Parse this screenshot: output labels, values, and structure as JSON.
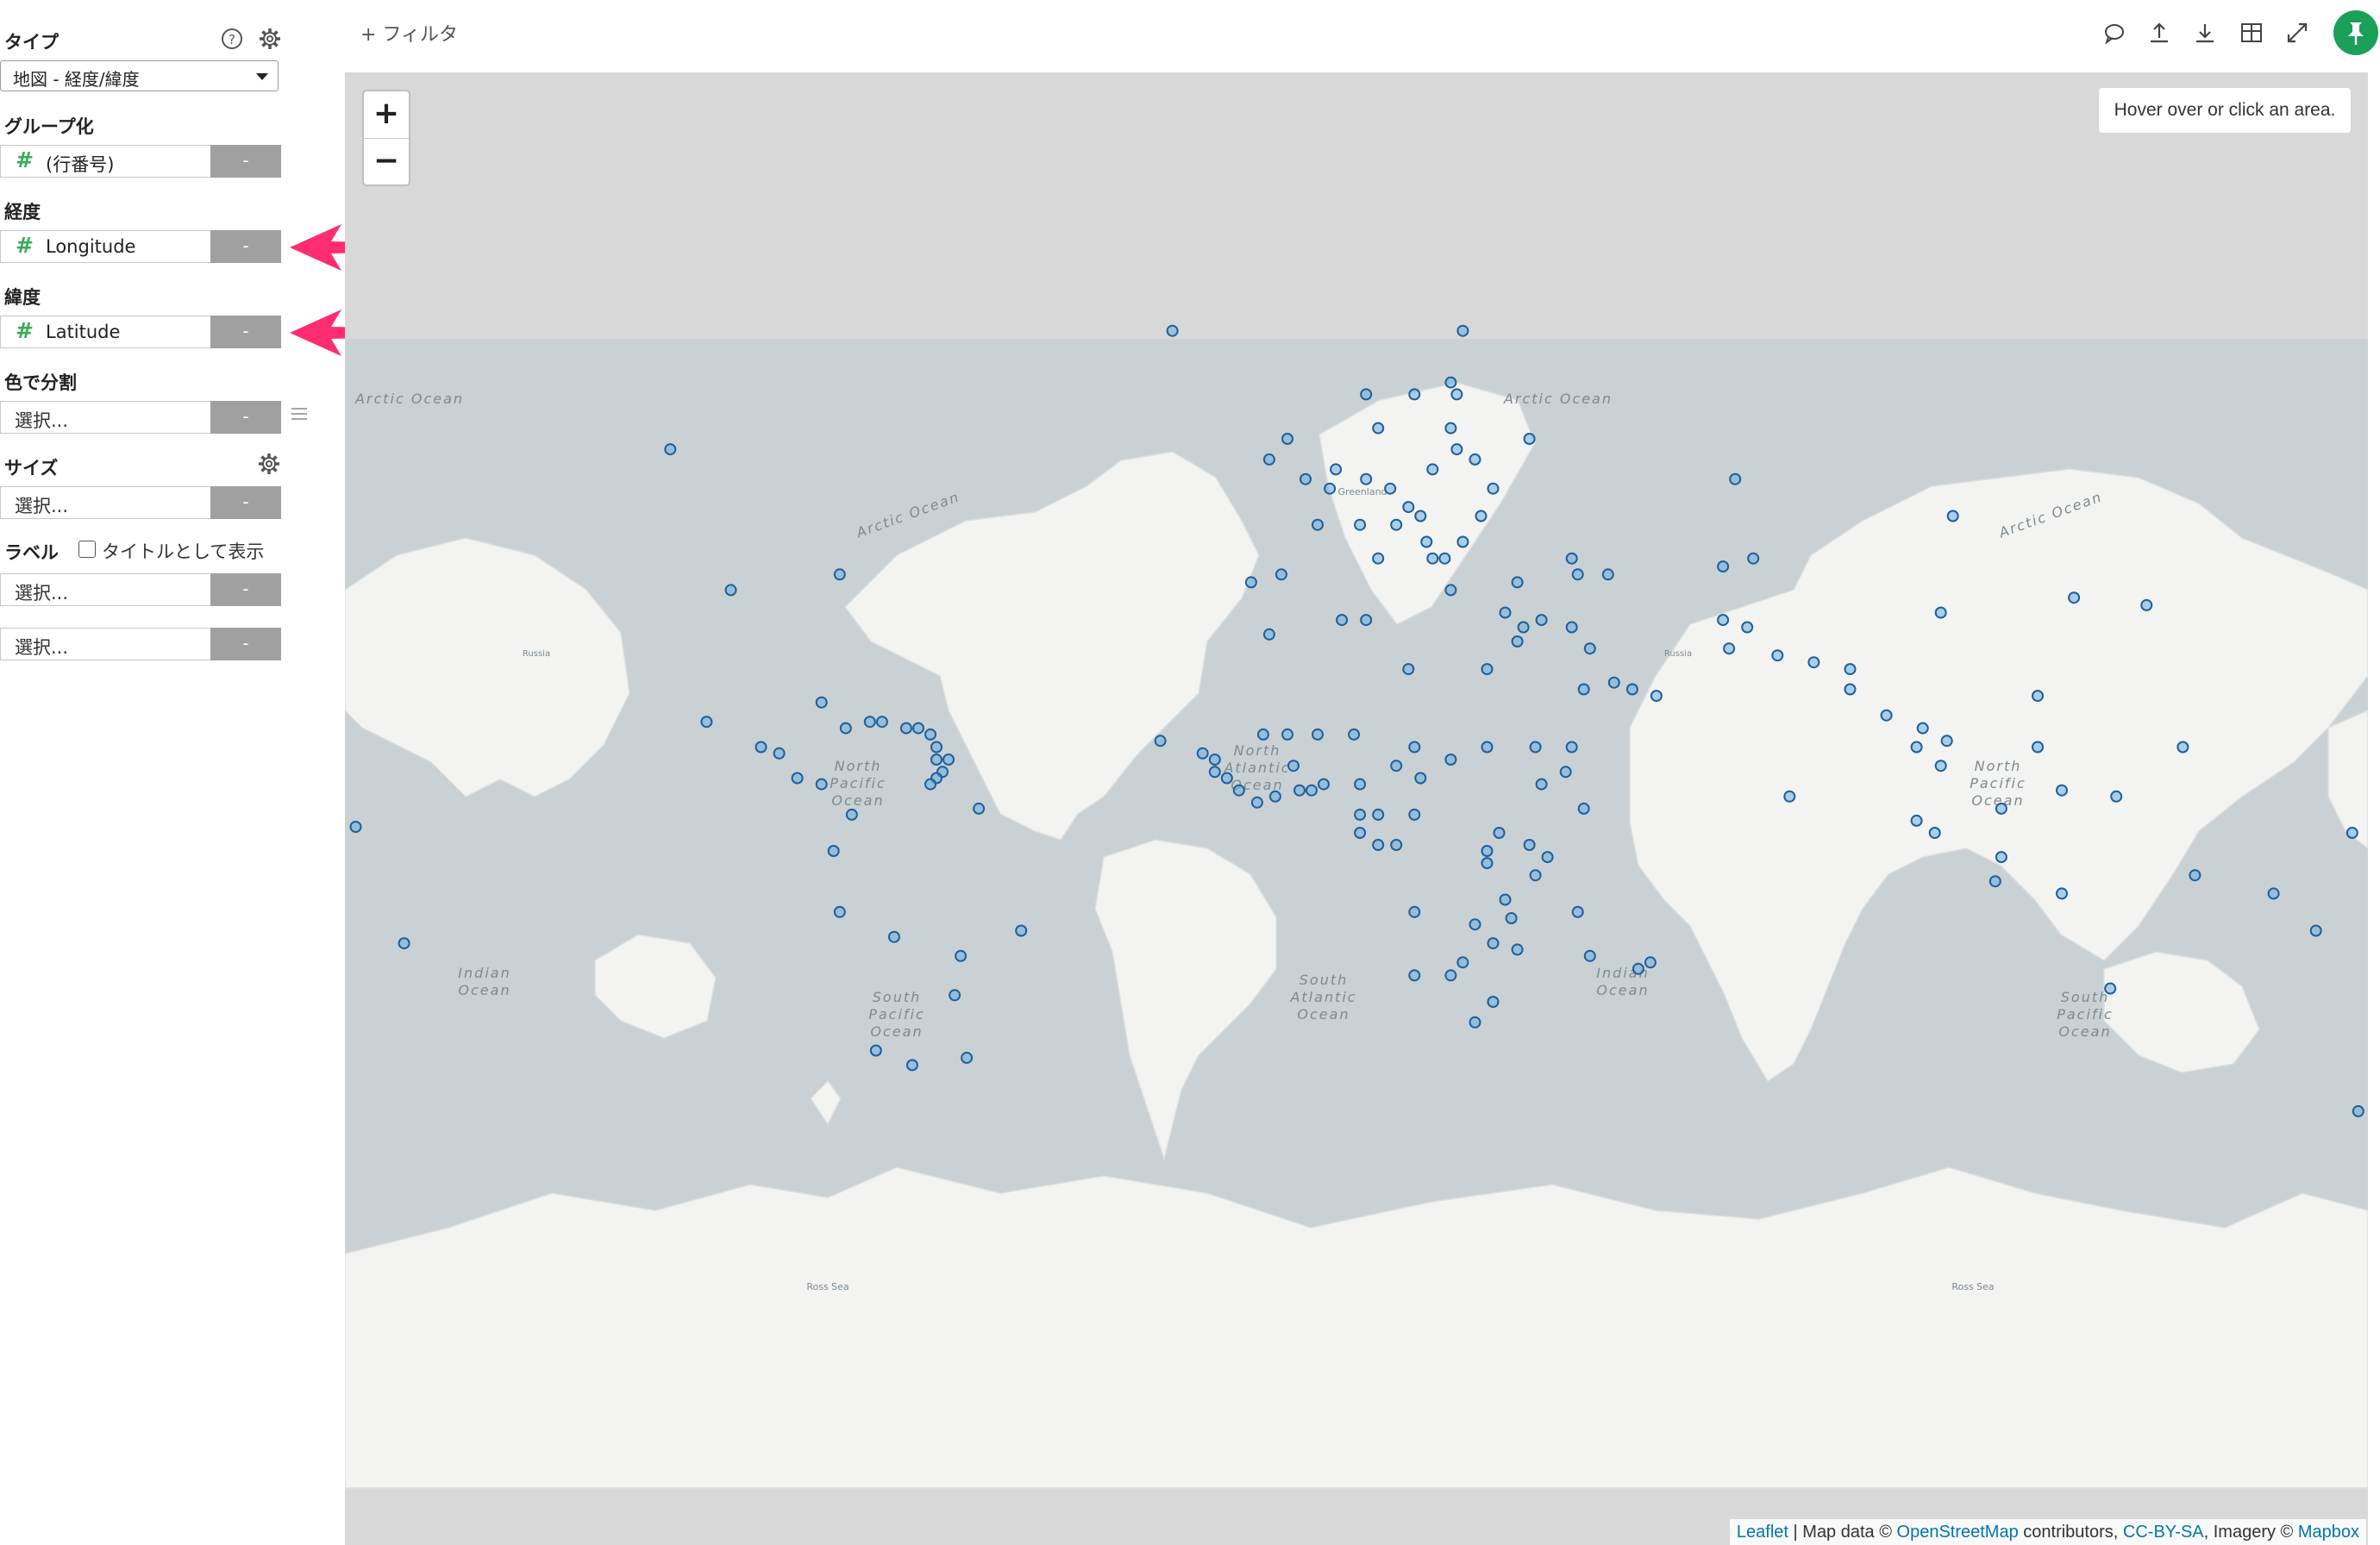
{
  "sidebar": {
    "type_label": "タイプ",
    "type_value": "地図 - 経度/緯度",
    "group_label": "グループ化",
    "group_field": "(行番号)",
    "lon_label": "経度",
    "lon_field": "Longitude",
    "lat_label": "緯度",
    "lat_field": "Latitude",
    "color_label": "色で分割",
    "color_placeholder": "選択...",
    "size_label": "サイズ",
    "size_placeholder": "選択...",
    "label_label": "ラベル",
    "label_checkbox": "タイトルとして表示",
    "label_placeholder1": "選択...",
    "label_placeholder2": "選択...",
    "remove_btn": "-",
    "hash": "#",
    "accent_color": "#3aaa59",
    "arrow_color": "#ff2d6f"
  },
  "topbar": {
    "filter_label": "+ フィルタ",
    "icons": [
      "comment-icon",
      "upload-icon",
      "download-icon",
      "table-icon",
      "expand-icon",
      "pin-icon"
    ],
    "pin_color": "#1aa058"
  },
  "map": {
    "zoom_in": "+",
    "zoom_out": "−",
    "info_text": "Hover over or click an area.",
    "attribution": {
      "leaflet": "Leaflet",
      "sep1": " | Map data © ",
      "osm": "OpenStreetMap",
      "contributors": " contributors, ",
      "license": "CC-BY-SA",
      "imagery": ", Imagery © ",
      "mapbox": "Mapbox"
    },
    "ocean_labels": {
      "arctic": "Arctic Ocean",
      "north_pacific": [
        "North",
        "Pacific",
        "Ocean"
      ],
      "north_atlantic": [
        "North",
        "Atlantic",
        "Ocean"
      ],
      "south_pacific": [
        "South",
        "Pacific",
        "Ocean"
      ],
      "south_atlantic": [
        "South",
        "Atlantic",
        "Ocean"
      ],
      "indian": [
        "Indian",
        "Ocean"
      ],
      "ross_sea": "Ross Sea",
      "greenland": "Greenland",
      "russia": "Russia"
    },
    "points": [
      [
        -22,
        64
      ],
      [
        -77,
        40
      ],
      [
        -95,
        38
      ],
      [
        -105,
        54
      ],
      [
        -99,
        19
      ],
      [
        -90,
        15
      ],
      [
        -87,
        14
      ],
      [
        -84,
        10
      ],
      [
        -80,
        9
      ],
      [
        -80,
        22
      ],
      [
        -76,
        18
      ],
      [
        -72,
        19
      ],
      [
        -70,
        19
      ],
      [
        -66,
        18
      ],
      [
        -64,
        18
      ],
      [
        -62,
        17
      ],
      [
        -61,
        15
      ],
      [
        -61,
        13
      ],
      [
        -60,
        11
      ],
      [
        -61,
        10
      ],
      [
        -62,
        9
      ],
      [
        -59,
        13
      ],
      [
        -75,
        4
      ],
      [
        -78,
        -2
      ],
      [
        -77,
        -12
      ],
      [
        -68,
        -16
      ],
      [
        -58,
        -25
      ],
      [
        -56,
        -34
      ],
      [
        -65,
        -35
      ],
      [
        -71,
        -33
      ],
      [
        -47,
        -15
      ],
      [
        -54,
        5
      ],
      [
        -57,
        -19
      ],
      [
        -149,
        -17
      ],
      [
        -175,
        -21
      ],
      [
        -172,
        -14
      ],
      [
        -157,
        2
      ],
      [
        -170,
        -14
      ],
      [
        -9,
        39
      ],
      [
        -4,
        40
      ],
      [
        2,
        46
      ],
      [
        0,
        51
      ],
      [
        -6,
        53
      ],
      [
        -3,
        55
      ],
      [
        4,
        50
      ],
      [
        5,
        52
      ],
      [
        10,
        51
      ],
      [
        14,
        50
      ],
      [
        9,
        46
      ],
      [
        12,
        42
      ],
      [
        15,
        46
      ],
      [
        17,
        48
      ],
      [
        19,
        47
      ],
      [
        21,
        52
      ],
      [
        25,
        54
      ],
      [
        24,
        56
      ],
      [
        25,
        59
      ],
      [
        24,
        60
      ],
      [
        18,
        59
      ],
      [
        10,
        59
      ],
      [
        12,
        56
      ],
      [
        26,
        64
      ],
      [
        21,
        42
      ],
      [
        23,
        42
      ],
      [
        20,
        44
      ],
      [
        26,
        44
      ],
      [
        29,
        47
      ],
      [
        31,
        50
      ],
      [
        37,
        55
      ],
      [
        28,
        53
      ],
      [
        24,
        38
      ],
      [
        33,
        35
      ],
      [
        35,
        39
      ],
      [
        35,
        31
      ],
      [
        36,
        33
      ],
      [
        39,
        34
      ],
      [
        44,
        33
      ],
      [
        47,
        30
      ],
      [
        51,
        25
      ],
      [
        54,
        24
      ],
      [
        46,
        24
      ],
      [
        58,
        23
      ],
      [
        44,
        15
      ],
      [
        45,
        40
      ],
      [
        44,
        42
      ],
      [
        50,
        40
      ],
      [
        69,
        41
      ],
      [
        71,
        51
      ],
      [
        74,
        42
      ],
      [
        69,
        34
      ],
      [
        70,
        30
      ],
      [
        73,
        33
      ],
      [
        78,
        29
      ],
      [
        80,
        7
      ],
      [
        84,
        28
      ],
      [
        90,
        24
      ],
      [
        90,
        27
      ],
      [
        96,
        20
      ],
      [
        101,
        15
      ],
      [
        102,
        18
      ],
      [
        105,
        12
      ],
      [
        106,
        16
      ],
      [
        104,
        1
      ],
      [
        101,
        3
      ],
      [
        115,
        5
      ],
      [
        121,
        15
      ],
      [
        121,
        23
      ],
      [
        127,
        37
      ],
      [
        139,
        36
      ],
      [
        105,
        35
      ],
      [
        107,
        47
      ],
      [
        114,
        -7
      ],
      [
        125,
        -9
      ],
      [
        147,
        -6
      ],
      [
        160,
        -9
      ],
      [
        167,
        -15
      ],
      [
        178,
        -18
      ],
      [
        174,
        -41
      ],
      [
        133,
        -24
      ],
      [
        134,
        7
      ],
      [
        145,
        15
      ],
      [
        173,
        1
      ],
      [
        125,
        8
      ],
      [
        115,
        -3
      ],
      [
        55,
        -21
      ],
      [
        57,
        -20
      ],
      [
        47,
        -19
      ],
      [
        38,
        -6
      ],
      [
        40,
        -3
      ],
      [
        37,
        -1
      ],
      [
        32,
        1
      ],
      [
        30,
        -2
      ],
      [
        30,
        -4
      ],
      [
        33,
        -10
      ],
      [
        34,
        -13
      ],
      [
        28,
        -14
      ],
      [
        26,
        -20
      ],
      [
        24,
        -22
      ],
      [
        31,
        -26
      ],
      [
        28,
        -29
      ],
      [
        31,
        -17
      ],
      [
        35,
        -18
      ],
      [
        45,
        -12
      ],
      [
        18,
        -12
      ],
      [
        18,
        -22
      ],
      [
        15,
        -1
      ],
      [
        12,
        -1
      ],
      [
        9,
        1
      ],
      [
        9,
        4
      ],
      [
        12,
        4
      ],
      [
        18,
        4
      ],
      [
        15,
        12
      ],
      [
        18,
        15
      ],
      [
        9,
        9
      ],
      [
        3,
        9
      ],
      [
        1,
        8
      ],
      [
        -1,
        8
      ],
      [
        -2,
        12
      ],
      [
        -5,
        7
      ],
      [
        -8,
        6
      ],
      [
        -11,
        8
      ],
      [
        -13,
        10
      ],
      [
        -15,
        13
      ],
      [
        -17,
        14
      ],
      [
        -15,
        11
      ],
      [
        -7,
        17
      ],
      [
        -3,
        17
      ],
      [
        2,
        17
      ],
      [
        8,
        17
      ],
      [
        19,
        10
      ],
      [
        24,
        13
      ],
      [
        30,
        15
      ],
      [
        38,
        15
      ],
      [
        39,
        9
      ],
      [
        43,
        11
      ],
      [
        46,
        5
      ],
      [
        6,
        34
      ],
      [
        10,
        34
      ],
      [
        17,
        27
      ],
      [
        30,
        27
      ],
      [
        -6,
        32
      ],
      [
        -24,
        16
      ]
    ]
  }
}
